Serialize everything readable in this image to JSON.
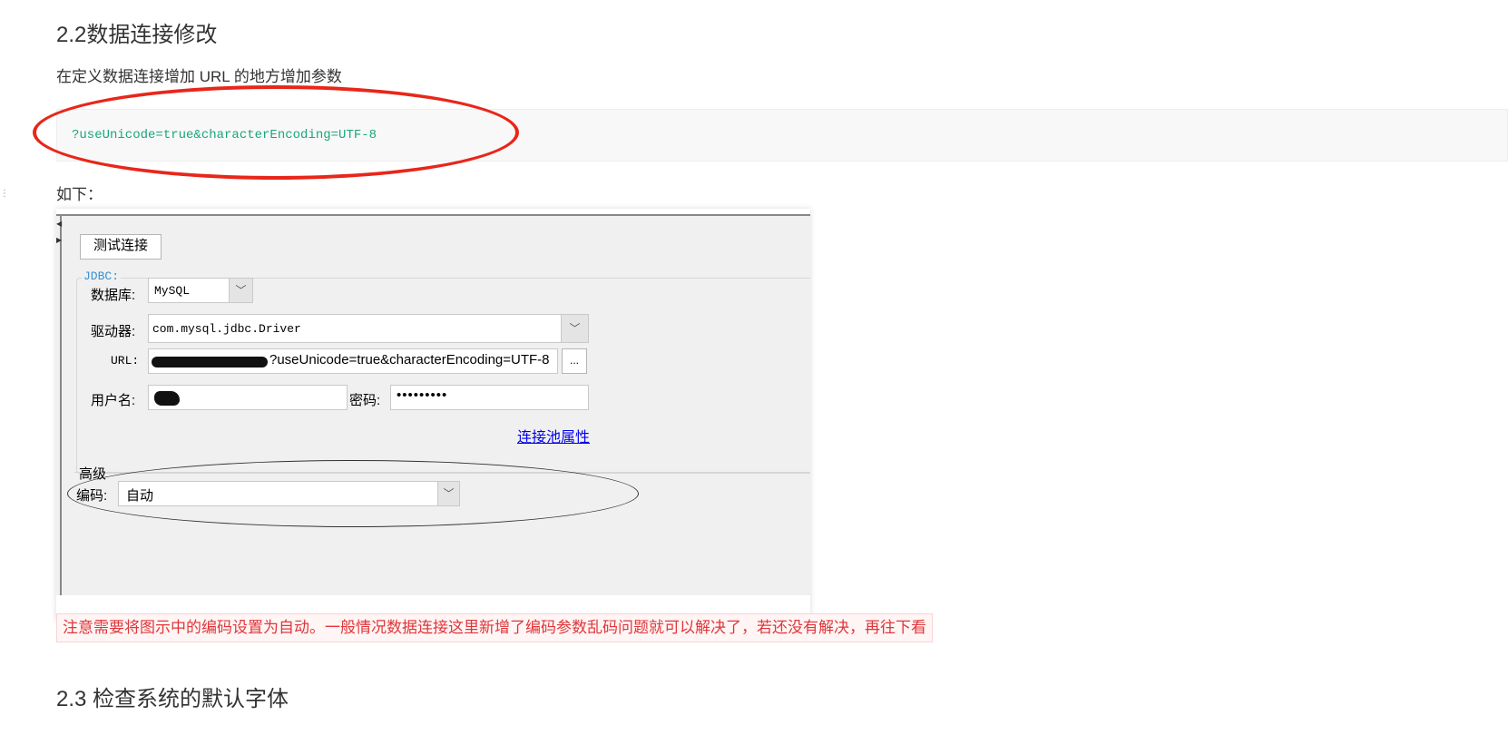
{
  "section_2_2": {
    "heading": "2.2数据连接修改",
    "intro": "在定义数据连接增加 URL 的地方增加参数",
    "code": "?useUnicode=true&characterEncoding=UTF-8",
    "as_below": "如下："
  },
  "dialog": {
    "test_connection_button": "测试连接",
    "jdbc_legend": "JDBC:",
    "database_label": "数据库:",
    "database_value": "MySQL",
    "driver_label": "驱动器:",
    "driver_value": "com.mysql.jdbc.Driver",
    "url_label": "URL:",
    "url_visible_suffix": "?useUnicode=true&characterEncoding=UTF-8",
    "url_more_button": "...",
    "username_label": "用户名:",
    "password_label": "密码:",
    "password_value": "•••••••••",
    "pool_properties_link": "连接池属性",
    "advanced_label": "高级",
    "encoding_label": "编码:",
    "encoding_value": "自动"
  },
  "note": "注意需要将图示中的编码设置为自动。一般情况数据连接这里新增了编码参数乱码问题就可以解决了，若还没有解决，再往下看",
  "section_2_3": {
    "heading": "2.3 检查系统的默认字体"
  },
  "colors": {
    "code_text": "#1aa67d",
    "annotation_red": "#e8261a",
    "note_text": "#e0363a",
    "link": "#0000ee"
  },
  "icons": {
    "dropdown": "chevron-down-icon"
  }
}
